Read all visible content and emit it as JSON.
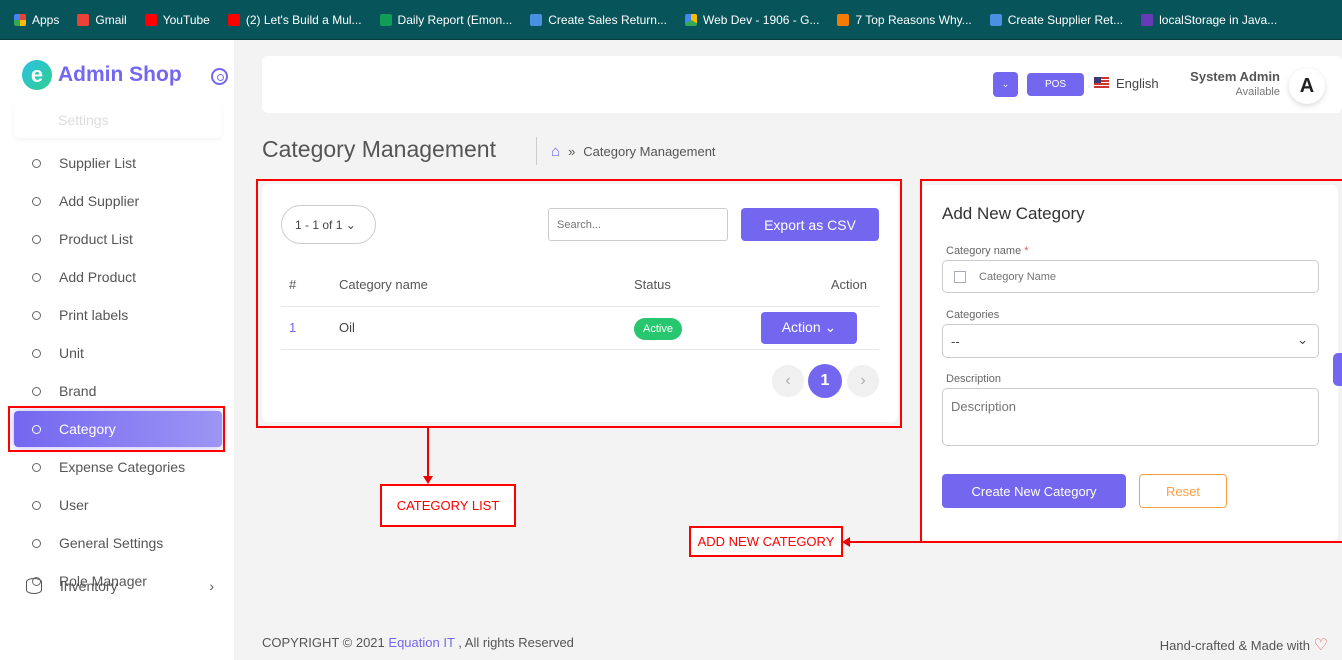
{
  "bookmarks": [
    "Apps",
    "Gmail",
    "YouTube",
    "(2) Let's Build a Mul...",
    "Daily Report (Emon...",
    "Create Sales Return...",
    "Web Dev - 1906 - G...",
    "7 Top Reasons Why...",
    "Create Supplier Ret...",
    "localStorage in Java..."
  ],
  "brand": "Admin Shop",
  "sidebar": {
    "settings": "Settings",
    "items": [
      "Supplier List",
      "Add Supplier",
      "Product List",
      "Add Product",
      "Print labels",
      "Unit",
      "Brand",
      "Category",
      "Expense Categories",
      "User",
      "General Settings",
      "Role Manager"
    ],
    "inventory": "Inventory"
  },
  "topbar": {
    "pos": "POS",
    "language": "English",
    "user": "System Admin",
    "status": "Available",
    "avatar": "A"
  },
  "page": {
    "title": "Category Management",
    "crumb": "Category Management"
  },
  "list": {
    "pager": "1 - 1 of 1",
    "search_placeholder": "Search...",
    "export": "Export as CSV",
    "headers": [
      "#",
      "Category name",
      "Status",
      "Action"
    ],
    "rows": [
      {
        "id": "1",
        "name": "Oil",
        "status": "Active",
        "action": "Action"
      }
    ],
    "page": "1"
  },
  "form": {
    "title": "Add New Category",
    "name_label": "Category name",
    "required": "*",
    "name_placeholder": "Category Name",
    "categories_label": "Categories",
    "categories_value": "--",
    "desc_label": "Description",
    "desc_placeholder": "Description",
    "create": "Create New Category",
    "reset": "Reset"
  },
  "annotations": {
    "list": "CATEGORY LIST",
    "add": "ADD NEW CATEGORY"
  },
  "footer": {
    "copyright": "COPYRIGHT © 2021",
    "company": "Equation IT",
    "rights": ", All rights Reserved",
    "made": "Hand-crafted & Made with"
  },
  "colors": {
    "primary": "#7367f0",
    "success": "#28c76f",
    "warning": "#ff9f43"
  }
}
